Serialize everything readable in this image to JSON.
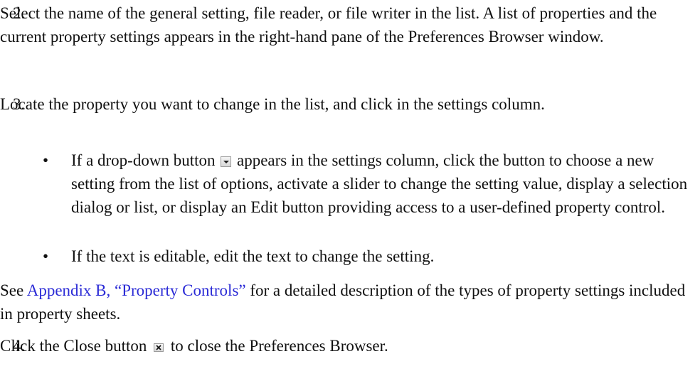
{
  "steps": [
    {
      "number": "2.",
      "text": "Select the name of the general setting, file reader, or file writer in the list. A list of properties and the current property settings appears in the right-hand pane of the Preferences Browser window."
    },
    {
      "number": "3.",
      "text": "Locate the property you want to change in the list, and click in the settings column.",
      "bullets": [
        {
          "symbol": "•",
          "before_icon": "If a drop-down button",
          "icon": "drop-down-arrow-icon",
          "after_icon": "appears in the settings column, click the button to choose a new setting from the list of options, activate a slider to change the setting value, display a selection dialog or list, or display an Edit button providing access to a user-defined property control."
        },
        {
          "symbol": "•",
          "text": "If the text is editable, edit the text to change the setting."
        }
      ],
      "see_prefix": "See ",
      "see_link": "Appendix B, “Property Controls”",
      "see_suffix": " for a detailed description of the types of property settings included in property sheets."
    },
    {
      "number": "4.",
      "before_icon": "Click the Close button",
      "icon": "close-x-icon",
      "after_icon": "to close the Preferences Browser."
    }
  ],
  "colors": {
    "text": "#111111",
    "link": "#2b2bd6"
  }
}
